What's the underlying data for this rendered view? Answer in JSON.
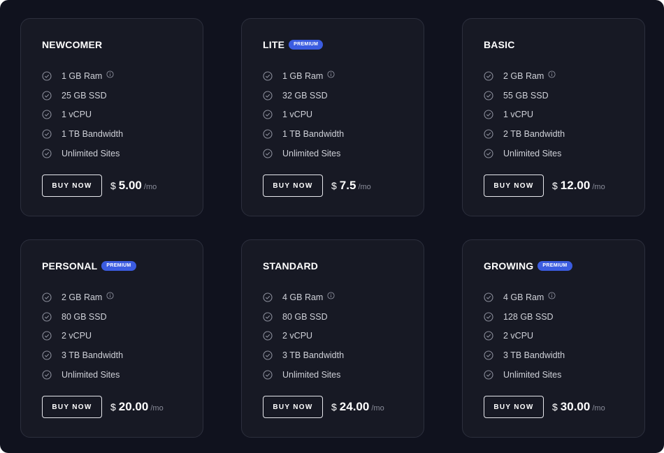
{
  "colors": {
    "background": "#10121e",
    "card": "#171924",
    "card_border": "#2c2f3d",
    "badge": "#3b5ce0",
    "text": "#ffffff",
    "muted": "#8a8d9a"
  },
  "plans": [
    {
      "name": "NEWCOMER",
      "badge": "",
      "features": [
        "1 GB Ram",
        "25 GB SSD",
        "1 vCPU",
        "1 TB Bandwidth",
        "Unlimited Sites"
      ],
      "button": "BUY NOW",
      "currency": "$",
      "price": "5.00",
      "period": "/mo"
    },
    {
      "name": "LITE",
      "badge": "PREMIUM",
      "features": [
        "1 GB Ram",
        "32 GB SSD",
        "1 vCPU",
        "1 TB Bandwidth",
        "Unlimited Sites"
      ],
      "button": "BUY NOW",
      "currency": "$",
      "price": "7.5",
      "period": "/mo"
    },
    {
      "name": "BASIC",
      "badge": "",
      "features": [
        "2 GB Ram",
        "55 GB SSD",
        "1 vCPU",
        "2 TB Bandwidth",
        "Unlimited Sites"
      ],
      "button": "BUY NOW",
      "currency": "$",
      "price": "12.00",
      "period": "/mo"
    },
    {
      "name": "PERSONAL",
      "badge": "PREMIUM",
      "features": [
        "2 GB Ram",
        "80 GB SSD",
        "2 vCPU",
        "3 TB Bandwidth",
        "Unlimited Sites"
      ],
      "button": "BUY NOW",
      "currency": "$",
      "price": "20.00",
      "period": "/mo"
    },
    {
      "name": "STANDARD",
      "badge": "",
      "features": [
        "4 GB Ram",
        "80 GB SSD",
        "2 vCPU",
        "3 TB Bandwidth",
        "Unlimited Sites"
      ],
      "button": "BUY NOW",
      "currency": "$",
      "price": "24.00",
      "period": "/mo"
    },
    {
      "name": "GROWING",
      "badge": "PREMIUM",
      "features": [
        "4 GB Ram",
        "128 GB SSD",
        "2 vCPU",
        "3 TB Bandwidth",
        "Unlimited Sites"
      ],
      "button": "BUY NOW",
      "currency": "$",
      "price": "30.00",
      "period": "/mo"
    }
  ]
}
